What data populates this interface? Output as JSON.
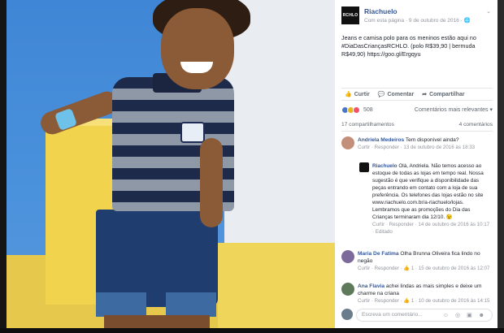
{
  "post": {
    "page_name": "Riachuelo",
    "page_logo_text": "RCHLO",
    "sub": "Com esta página · 9 de outubro de 2016 · ",
    "text_main": "Jeans e camisa polo para os meninos estão aqui no #DiaDasCriançasRCHLO. (polo R$39,90 | bermuda R$49,90) https://goo.gl/Ergqyu",
    "caret": "⌄"
  },
  "actions": {
    "like": "Curtir",
    "comment": "Comentar",
    "share": "Compartilhar"
  },
  "reactions": {
    "count": "508",
    "relevance": "Comentários mais relevantes ▾",
    "colors": [
      "#4a76c9",
      "#e8b51a",
      "#f25268"
    ]
  },
  "shares": {
    "left": "17 compartilhamentos",
    "right": "4 comentários"
  },
  "comments": [
    {
      "name": "Andriela Medeiros",
      "text": " Tem disponível ainda?",
      "meta": "Curtir · Responder · 13 de outubro de 2016 às 18:33"
    },
    {
      "name": "Riachuelo",
      "text": " Olá, Andriela. Não temos acesso ao estoque de todas as lojas em tempo real. Nossa sugestão é que verifique a disponibilidade das peças entrando em contato com a loja de sua preferência. Os telefones das lojas estão no site www.riachuelo.com.br/a-riachuelo/lojas. Lembramos que as promoções do Dia das Crianças terminaram dia 12/10. 😉",
      "meta": "Curtir · Responder · 14 de outubro de 2016 às 10:17 · Editado"
    },
    {
      "name": "Maria De Fatima",
      "text": " Olha Brunna Oliveira fica lindo no negão",
      "meta": "Curtir · Responder · 👍 1 · 15 de outubro de 2016 às 12:07"
    },
    {
      "name": "Ana Flavia",
      "text": " achei lindas as mais simples e deixe um charme na criana",
      "meta": "Curtir · Responder · 👍 1 · 10 de outubro de 2016 às 14:15"
    }
  ],
  "write": {
    "placeholder": "Escreva um comentário...",
    "icons": "☺ ◎ ▣ ☻"
  }
}
